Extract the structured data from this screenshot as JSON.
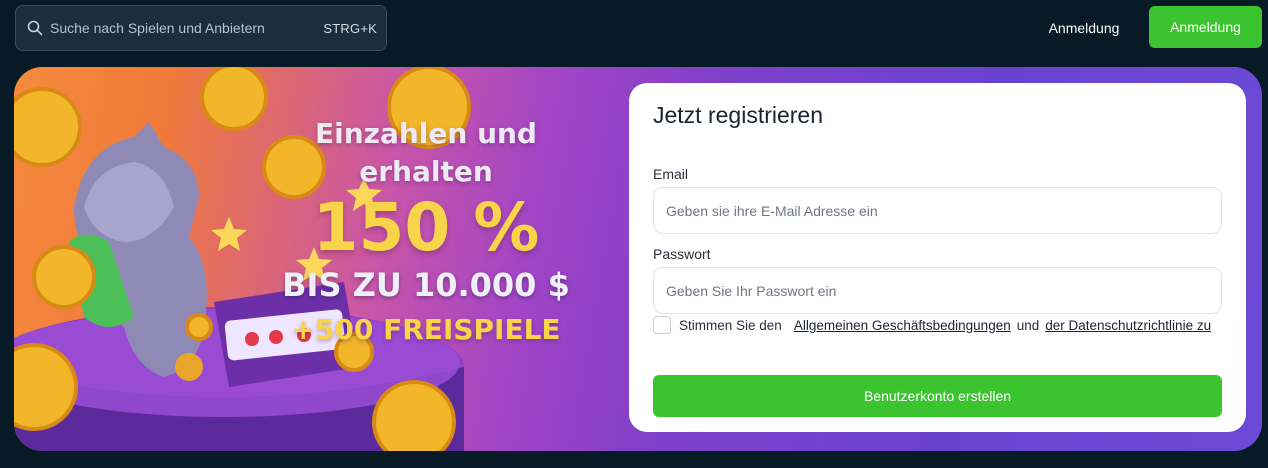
{
  "header": {
    "search": {
      "placeholder": "Suche nach Spielen und Anbietern",
      "shortcut": "STRG+K",
      "icon": "search-icon"
    },
    "login_link": "Anmeldung",
    "login_button": "Anmeldung"
  },
  "banner": {
    "promo": {
      "line1": "Einzahlen und",
      "line2": "erhalten",
      "percent": "150 %",
      "amount": "BIS ZU 10.000 $",
      "spins": "+500 FREISPIELE"
    }
  },
  "register": {
    "title": "Jetzt registrieren",
    "email_label": "Email",
    "email_placeholder": "Geben sie ihre E-Mail Adresse ein",
    "password_label": "Passwort",
    "password_placeholder": "Geben Sie Ihr Passwort ein",
    "terms_prefix": "Stimmen Sie den",
    "terms_link": "Allgemeinen Geschäftsbedingungen",
    "terms_middle": "und",
    "privacy_link": "der Datenschutzrichtlinie zu",
    "submit": "Benutzerkonto erstellen"
  },
  "colors": {
    "page_bg": "#081a26",
    "accent_green": "#3cc430",
    "promo_yellow": "#f8d44a"
  }
}
